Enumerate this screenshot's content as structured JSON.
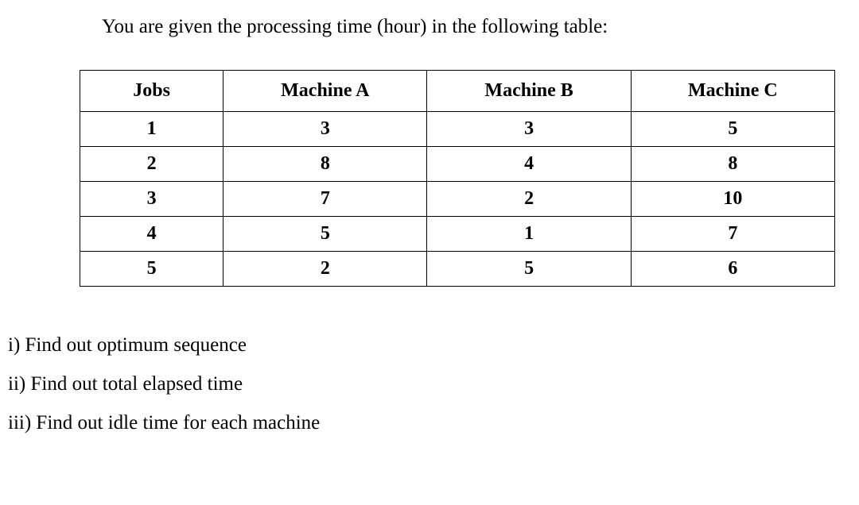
{
  "intro": "You are given the processing time (hour) in the following table:",
  "table": {
    "headers": {
      "jobs": "Jobs",
      "machineA": "Machine A",
      "machineB": "Machine B",
      "machineC": "Machine C"
    },
    "rows": [
      {
        "job": "1",
        "a": "3",
        "b": "3",
        "c": "5"
      },
      {
        "job": "2",
        "a": "8",
        "b": "4",
        "c": "8"
      },
      {
        "job": "3",
        "a": "7",
        "b": "2",
        "c": "10"
      },
      {
        "job": "4",
        "a": "5",
        "b": "1",
        "c": "7"
      },
      {
        "job": "5",
        "a": "2",
        "b": "5",
        "c": "6"
      }
    ]
  },
  "questions": {
    "q1": "i) Find out optimum sequence",
    "q2": "ii)  Find out total elapsed time",
    "q3": "iii) Find out idle time for each machine"
  },
  "chart_data": {
    "type": "table",
    "title": "Processing time (hour)",
    "columns": [
      "Jobs",
      "Machine A",
      "Machine B",
      "Machine C"
    ],
    "data": [
      [
        1,
        3,
        3,
        5
      ],
      [
        2,
        8,
        4,
        8
      ],
      [
        3,
        7,
        2,
        10
      ],
      [
        4,
        5,
        1,
        7
      ],
      [
        5,
        2,
        5,
        6
      ]
    ]
  }
}
